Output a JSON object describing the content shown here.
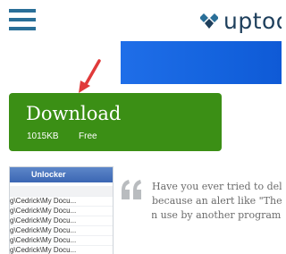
{
  "header": {
    "logo_text": "uptod",
    "brand_color": "#1e3f5c",
    "menu_icon": "hamburger-icon"
  },
  "banner": {
    "color": "#1463de"
  },
  "annotation": {
    "arrow_color": "#e03a3a"
  },
  "download": {
    "title": "Download",
    "size": "1015KB",
    "license": "Free",
    "color": "#3b8f15"
  },
  "screenshot": {
    "window_title": "Unlocker",
    "rows": [
      "",
      "g\\Cedrick\\My Docu...",
      "g\\Cedrick\\My Docu...",
      "g\\Cedrick\\My Docu...",
      "g\\Cedrick\\My Docu...",
      "g\\Cedrick\\My Docu...",
      "g\\Cedrick\\My Docu..."
    ]
  },
  "description": {
    "lines": [
      "Have you ever tried to dele",
      "because an alert like \"The s",
      "file is in use by another program"
    ]
  }
}
